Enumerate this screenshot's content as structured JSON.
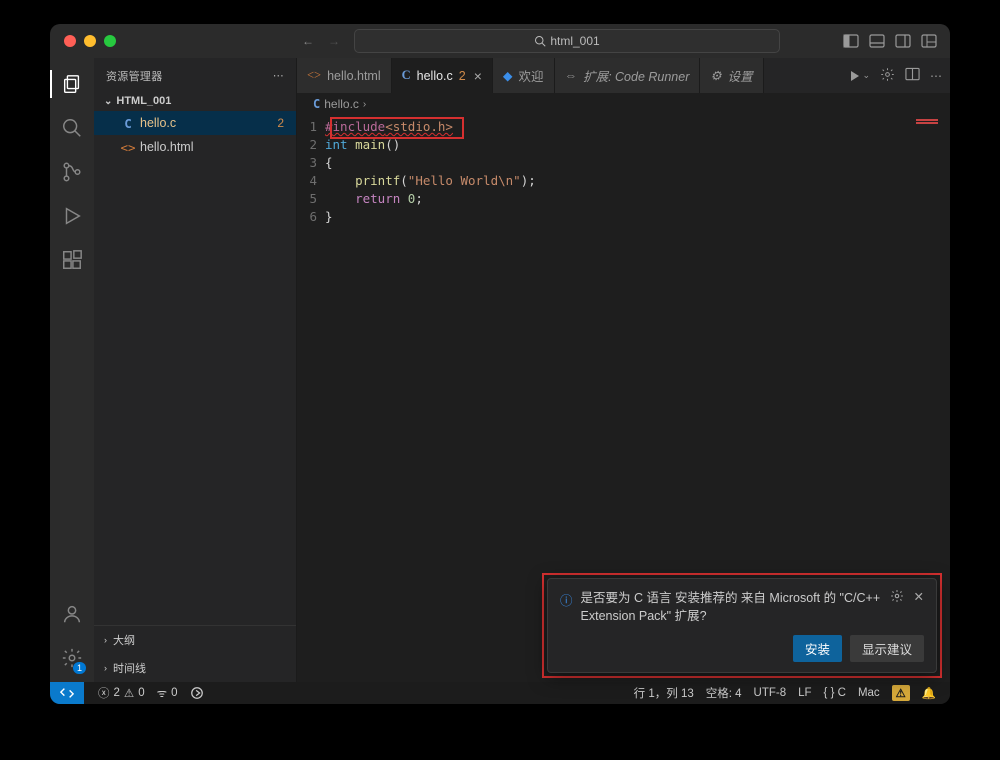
{
  "search": {
    "text": "html_001"
  },
  "sidebar": {
    "title": "资源管理器",
    "folder": "HTML_001",
    "files": [
      {
        "icon": "C",
        "name": "hello.c",
        "selected": true,
        "badge": "2"
      },
      {
        "icon": "<>",
        "name": "hello.html",
        "selected": false
      }
    ],
    "outline": "大纲",
    "timeline": "时间线"
  },
  "tabs": [
    {
      "icon": "<>",
      "label": "hello.html",
      "active": false
    },
    {
      "icon": "C",
      "label": "hello.c",
      "active": true,
      "badge": "2",
      "close": true
    },
    {
      "icon": "vs",
      "label": "欢迎",
      "active": false
    },
    {
      "label": "扩展: Code Runner",
      "pre": "⇔",
      "active": false
    },
    {
      "label": "设置",
      "pre": "⚙",
      "active": false
    }
  ],
  "breadcrumb": {
    "icon": "C",
    "file": "hello.c"
  },
  "code": {
    "lines": [
      {
        "n": "1",
        "html": "<span class='inc squig'>#include</span><span class='str squig'>&lt;stdio.h&gt;</span>"
      },
      {
        "n": "2",
        "html": "<span class='ty'>int</span> <span class='fn'>main</span><span class='pl'>()</span>"
      },
      {
        "n": "3",
        "html": "<span class='pl'>{</span>"
      },
      {
        "n": "4",
        "html": "    <span class='fn'>printf</span><span class='pl'>(</span><span class='str'>\"Hello World\\n\"</span><span class='pl'>);</span>"
      },
      {
        "n": "5",
        "html": "    <span class='kwd'>return</span> <span class='num'>0</span><span class='pl'>;</span>"
      },
      {
        "n": "6",
        "html": "<span class='pl'>}</span>"
      }
    ]
  },
  "notif": {
    "msg": "是否要为 C 语言 安装推荐的 来自 Microsoft 的 \"C/C++ Extension Pack\" 扩展?",
    "install": "安装",
    "show": "显示建议"
  },
  "status": {
    "errors": "2",
    "warnings": "0",
    "ports": "0",
    "pos": "行 1，列 13",
    "spaces": "空格: 4",
    "enc": "UTF-8",
    "eol": "LF",
    "lang": "{ } C",
    "os": "Mac"
  }
}
